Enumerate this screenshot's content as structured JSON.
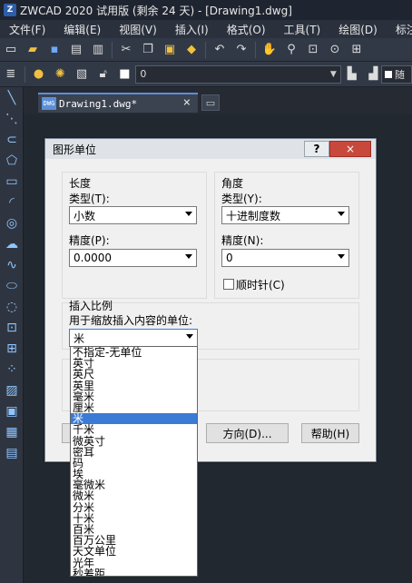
{
  "window": {
    "title": "ZWCAD 2020 试用版 (剩余 24 天) - [Drawing1.dwg]"
  },
  "menu": [
    "文件(F)",
    "编辑(E)",
    "视图(V)",
    "插入(I)",
    "格式(O)",
    "工具(T)",
    "绘图(D)",
    "标注"
  ],
  "layer_toolbar": {
    "layer_value": "0",
    "color_value": "随"
  },
  "tab": {
    "label": "Drawing1.dwg*",
    "close": "×"
  },
  "dialog": {
    "title": "图形单位",
    "help_label": "?",
    "close_label": "×",
    "length": {
      "group_label": "长度",
      "type_label": "类型(T):",
      "type_value": "小数",
      "precision_label": "精度(P):",
      "precision_value": "0.0000"
    },
    "angle": {
      "group_label": "角度",
      "type_label": "类型(Y):",
      "type_value": "十进制度数",
      "precision_label": "精度(N):",
      "precision_value": "0",
      "clockwise_label": "顺时针(C)",
      "clockwise_checked": false
    },
    "insert_scale": {
      "group_label": "插入比例",
      "description": "用于缩放插入内容的单位:",
      "value": "米"
    },
    "buttons": {
      "direction": "方向(D)...",
      "help": "帮助(H)"
    }
  },
  "unit_list": {
    "items": [
      "不指定-无单位",
      "英寸",
      "英尺",
      "英里",
      "毫米",
      "厘米",
      "米",
      "千米",
      "微英寸",
      "密耳",
      "码",
      "埃",
      "毫微米",
      "微米",
      "分米",
      "十米",
      "百米",
      "百万公里",
      "天文单位",
      "光年",
      "秒差距"
    ],
    "selected_index": 6
  }
}
